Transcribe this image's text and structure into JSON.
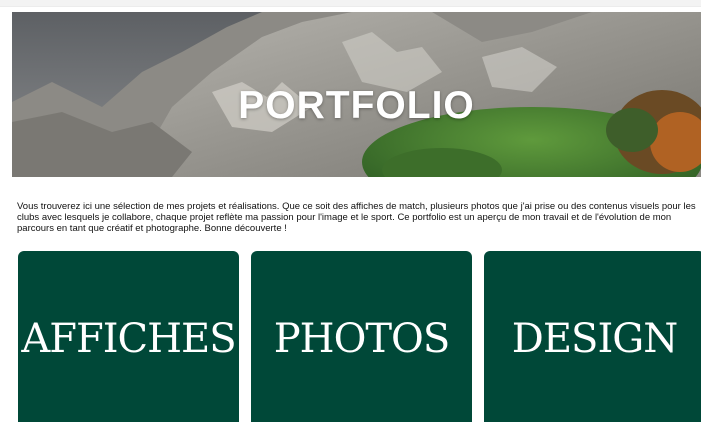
{
  "hero": {
    "title": "PORTFOLIO"
  },
  "intro": {
    "text": "Vous trouverez ici une sélection de mes projets et réalisations. Que ce soit des affiches de match, plusieurs photos que j'ai prise ou des contenus visuels pour les clubs avec lesquels je collabore, chaque projet reflète ma passion pour l'image et le sport. Ce portfolio est un aperçu de mon travail et de l'évolution de mon parcours en tant que créatif et photographe. Bonne découverte !"
  },
  "cards": [
    {
      "label": "AFFICHES"
    },
    {
      "label": "PHOTOS"
    },
    {
      "label": "DESIGN"
    }
  ],
  "colors": {
    "card_background": "#004838",
    "card_text": "#ffffff",
    "hero_title": "#ffffff"
  }
}
